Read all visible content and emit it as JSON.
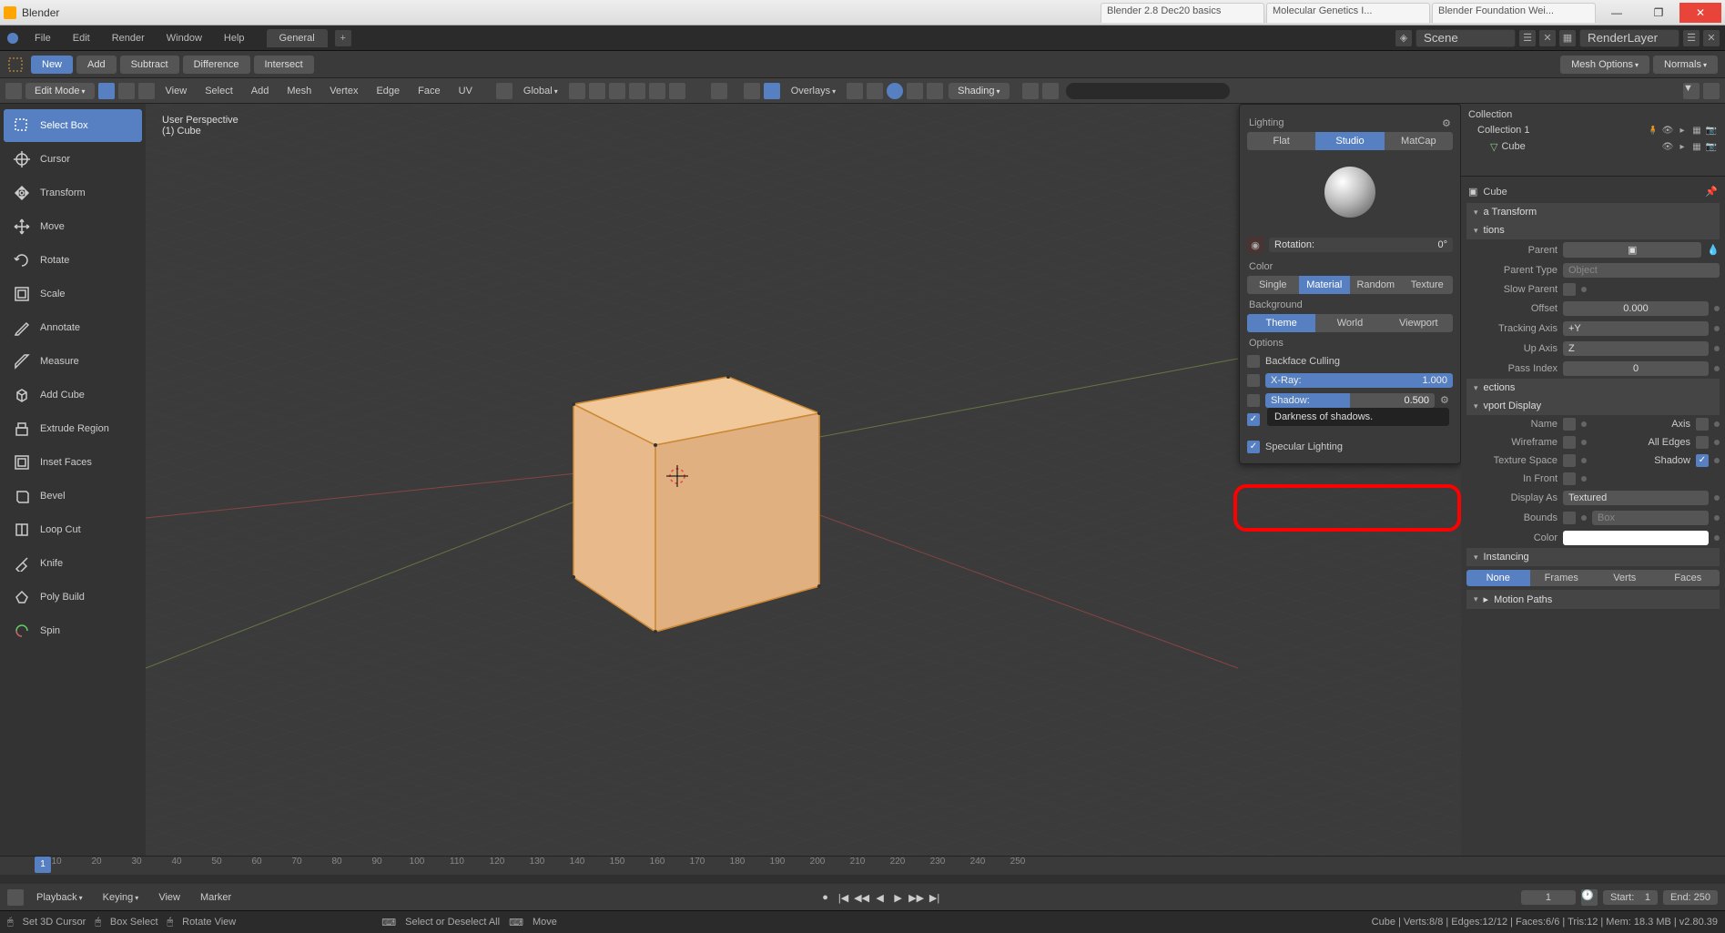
{
  "titlebar": {
    "title": "Blender",
    "tabs": [
      "Blender 2.8 Dec20 basics",
      "Molecular Genetics I...",
      "Blender Foundation Wei..."
    ]
  },
  "win": {
    "min": "—",
    "max": "❐",
    "close": "✕"
  },
  "topmenu": {
    "items": [
      "File",
      "Edit",
      "Render",
      "Window",
      "Help"
    ],
    "workspace": "General",
    "scene": "Scene",
    "renderlayer": "RenderLayer"
  },
  "boolops": {
    "new": "New",
    "add": "Add",
    "subtract": "Subtract",
    "difference": "Difference",
    "intersect": "Intersect",
    "meshopts": "Mesh Options",
    "normals": "Normals"
  },
  "header2": {
    "mode": "Edit Mode",
    "menus": [
      "View",
      "Select",
      "Add",
      "Mesh",
      "Vertex",
      "Edge",
      "Face",
      "UV"
    ],
    "orient": "Global",
    "overlays": "Overlays",
    "shading": "Shading"
  },
  "viewport": {
    "line1": "User Perspective",
    "line2": "(1) Cube"
  },
  "tools": [
    "Select Box",
    "Cursor",
    "Transform",
    "Move",
    "Rotate",
    "Scale",
    "Annotate",
    "Measure",
    "Add Cube",
    "Extrude Region",
    "Inset Faces",
    "Bevel",
    "Loop Cut",
    "Knife",
    "Poly Build",
    "Spin"
  ],
  "popover": {
    "lighting": "Lighting",
    "flat": "Flat",
    "studio": "Studio",
    "matcap": "MatCap",
    "rotation": "Rotation:",
    "rotation_val": "0°",
    "color": "Color",
    "single": "Single",
    "material": "Material",
    "random": "Random",
    "texture": "Texture",
    "background": "Background",
    "theme": "Theme",
    "world": "World",
    "viewport_bg": "Viewport",
    "options": "Options",
    "backface": "Backface Culling",
    "xray": "X-Ray:",
    "xray_val": "1.000",
    "shadow": "Shadow:",
    "shadow_val": "0.500",
    "specular": "Specular Lighting",
    "tooltip": "Darkness of shadows."
  },
  "outliner": {
    "collection": "Collection",
    "col1": "Collection 1",
    "cube": "Cube"
  },
  "props": {
    "objname": "Cube",
    "transform": "a Transform",
    "tions": "tions",
    "parent": "Parent",
    "parent_type": "Parent Type",
    "parent_type_val": "Object",
    "slow_parent": "Slow Parent",
    "offset": "Offset",
    "offset_val": "0.000",
    "tracking": "Tracking Axis",
    "tracking_val": "+Y",
    "upaxis": "Up Axis",
    "upaxis_val": "Z",
    "passidx": "Pass Index",
    "passidx_val": "0",
    "ections": "ections",
    "vpdisplay": "vport Display",
    "name": "Name",
    "axis": "Axis",
    "wireframe": "Wireframe",
    "alledges": "All Edges",
    "tspace": "Texture Space",
    "shadowchk": "Shadow",
    "infront": "In Front",
    "displayas": "Display As",
    "displayas_val": "Textured",
    "bounds": "Bounds",
    "bounds_val": "Box",
    "colorlbl": "Color",
    "instancing": "Instancing",
    "none": "None",
    "frames": "Frames",
    "verts": "Verts",
    "faces": "Faces",
    "motionpaths": "Motion Paths"
  },
  "timeline": {
    "playback": "Playback",
    "keying": "Keying",
    "view": "View",
    "marker": "Marker",
    "current": "1",
    "start": "Start:",
    "start_val": "1",
    "end": "End:",
    "end_val": "250",
    "ticks": [
      "10",
      "20",
      "30",
      "40",
      "50",
      "60",
      "70",
      "80",
      "90",
      "100",
      "110",
      "120",
      "130",
      "140",
      "150",
      "160",
      "170",
      "180",
      "190",
      "200",
      "210",
      "220",
      "230",
      "240",
      "250"
    ]
  },
  "status": {
    "cursor": "Set 3D Cursor",
    "box": "Box Select",
    "rotate": "Rotate View",
    "select_des": "Select or Deselect All",
    "move": "Move",
    "right": "Cube | Verts:8/8 | Edges:12/12 | Faces:6/6 | Tris:12 | Mem: 18.3 MB | v2.80.39"
  }
}
